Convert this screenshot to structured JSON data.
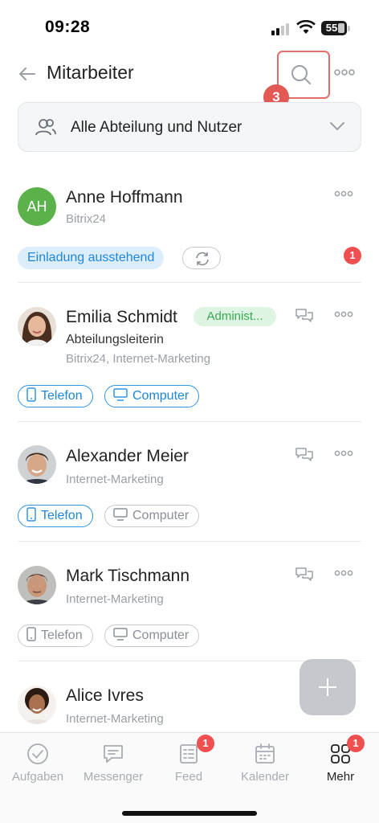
{
  "status_bar": {
    "time": "09:28",
    "battery": "55"
  },
  "header": {
    "title": "Mitarbeiter",
    "step_badge": "3"
  },
  "filter": {
    "label": "Alle Abteilung und Nutzer"
  },
  "employees": [
    {
      "initials": "AH",
      "name": "Anne Hoffmann",
      "subtitle": "Bitrix24",
      "invite_label": "Einladung ausstehend",
      "counter": "1"
    },
    {
      "name": "Emilia Schmidt",
      "badge": "Administ...",
      "role": "Abteilungsleiterin",
      "subtitle": "Bitrix24, Internet-Marketing",
      "chip_phone": "Telefon",
      "chip_computer": "Computer"
    },
    {
      "name": "Alexander Meier",
      "subtitle": "Internet-Marketing",
      "chip_phone": "Telefon",
      "chip_computer": "Computer"
    },
    {
      "name": "Mark Tischmann",
      "subtitle": "Internet-Marketing",
      "chip_phone": "Telefon",
      "chip_computer": "Computer"
    },
    {
      "name": "Alice Ivres",
      "subtitle": "Internet-Marketing"
    }
  ],
  "tabbar": {
    "tabs": [
      {
        "label": "Aufgaben",
        "icon": "tasks-icon"
      },
      {
        "label": "Messenger",
        "icon": "messenger-icon"
      },
      {
        "label": "Feed",
        "icon": "feed-icon",
        "badge": "1"
      },
      {
        "label": "Kalender",
        "icon": "calendar-icon"
      },
      {
        "label": "Mehr",
        "icon": "more-grid-icon",
        "badge": "1",
        "active": true
      }
    ]
  },
  "colors": {
    "accent_blue": "#1e86db",
    "badge_red": "#ef4f4f",
    "admin_green": "#3ca852",
    "highlight_red": "#e26d6b"
  }
}
